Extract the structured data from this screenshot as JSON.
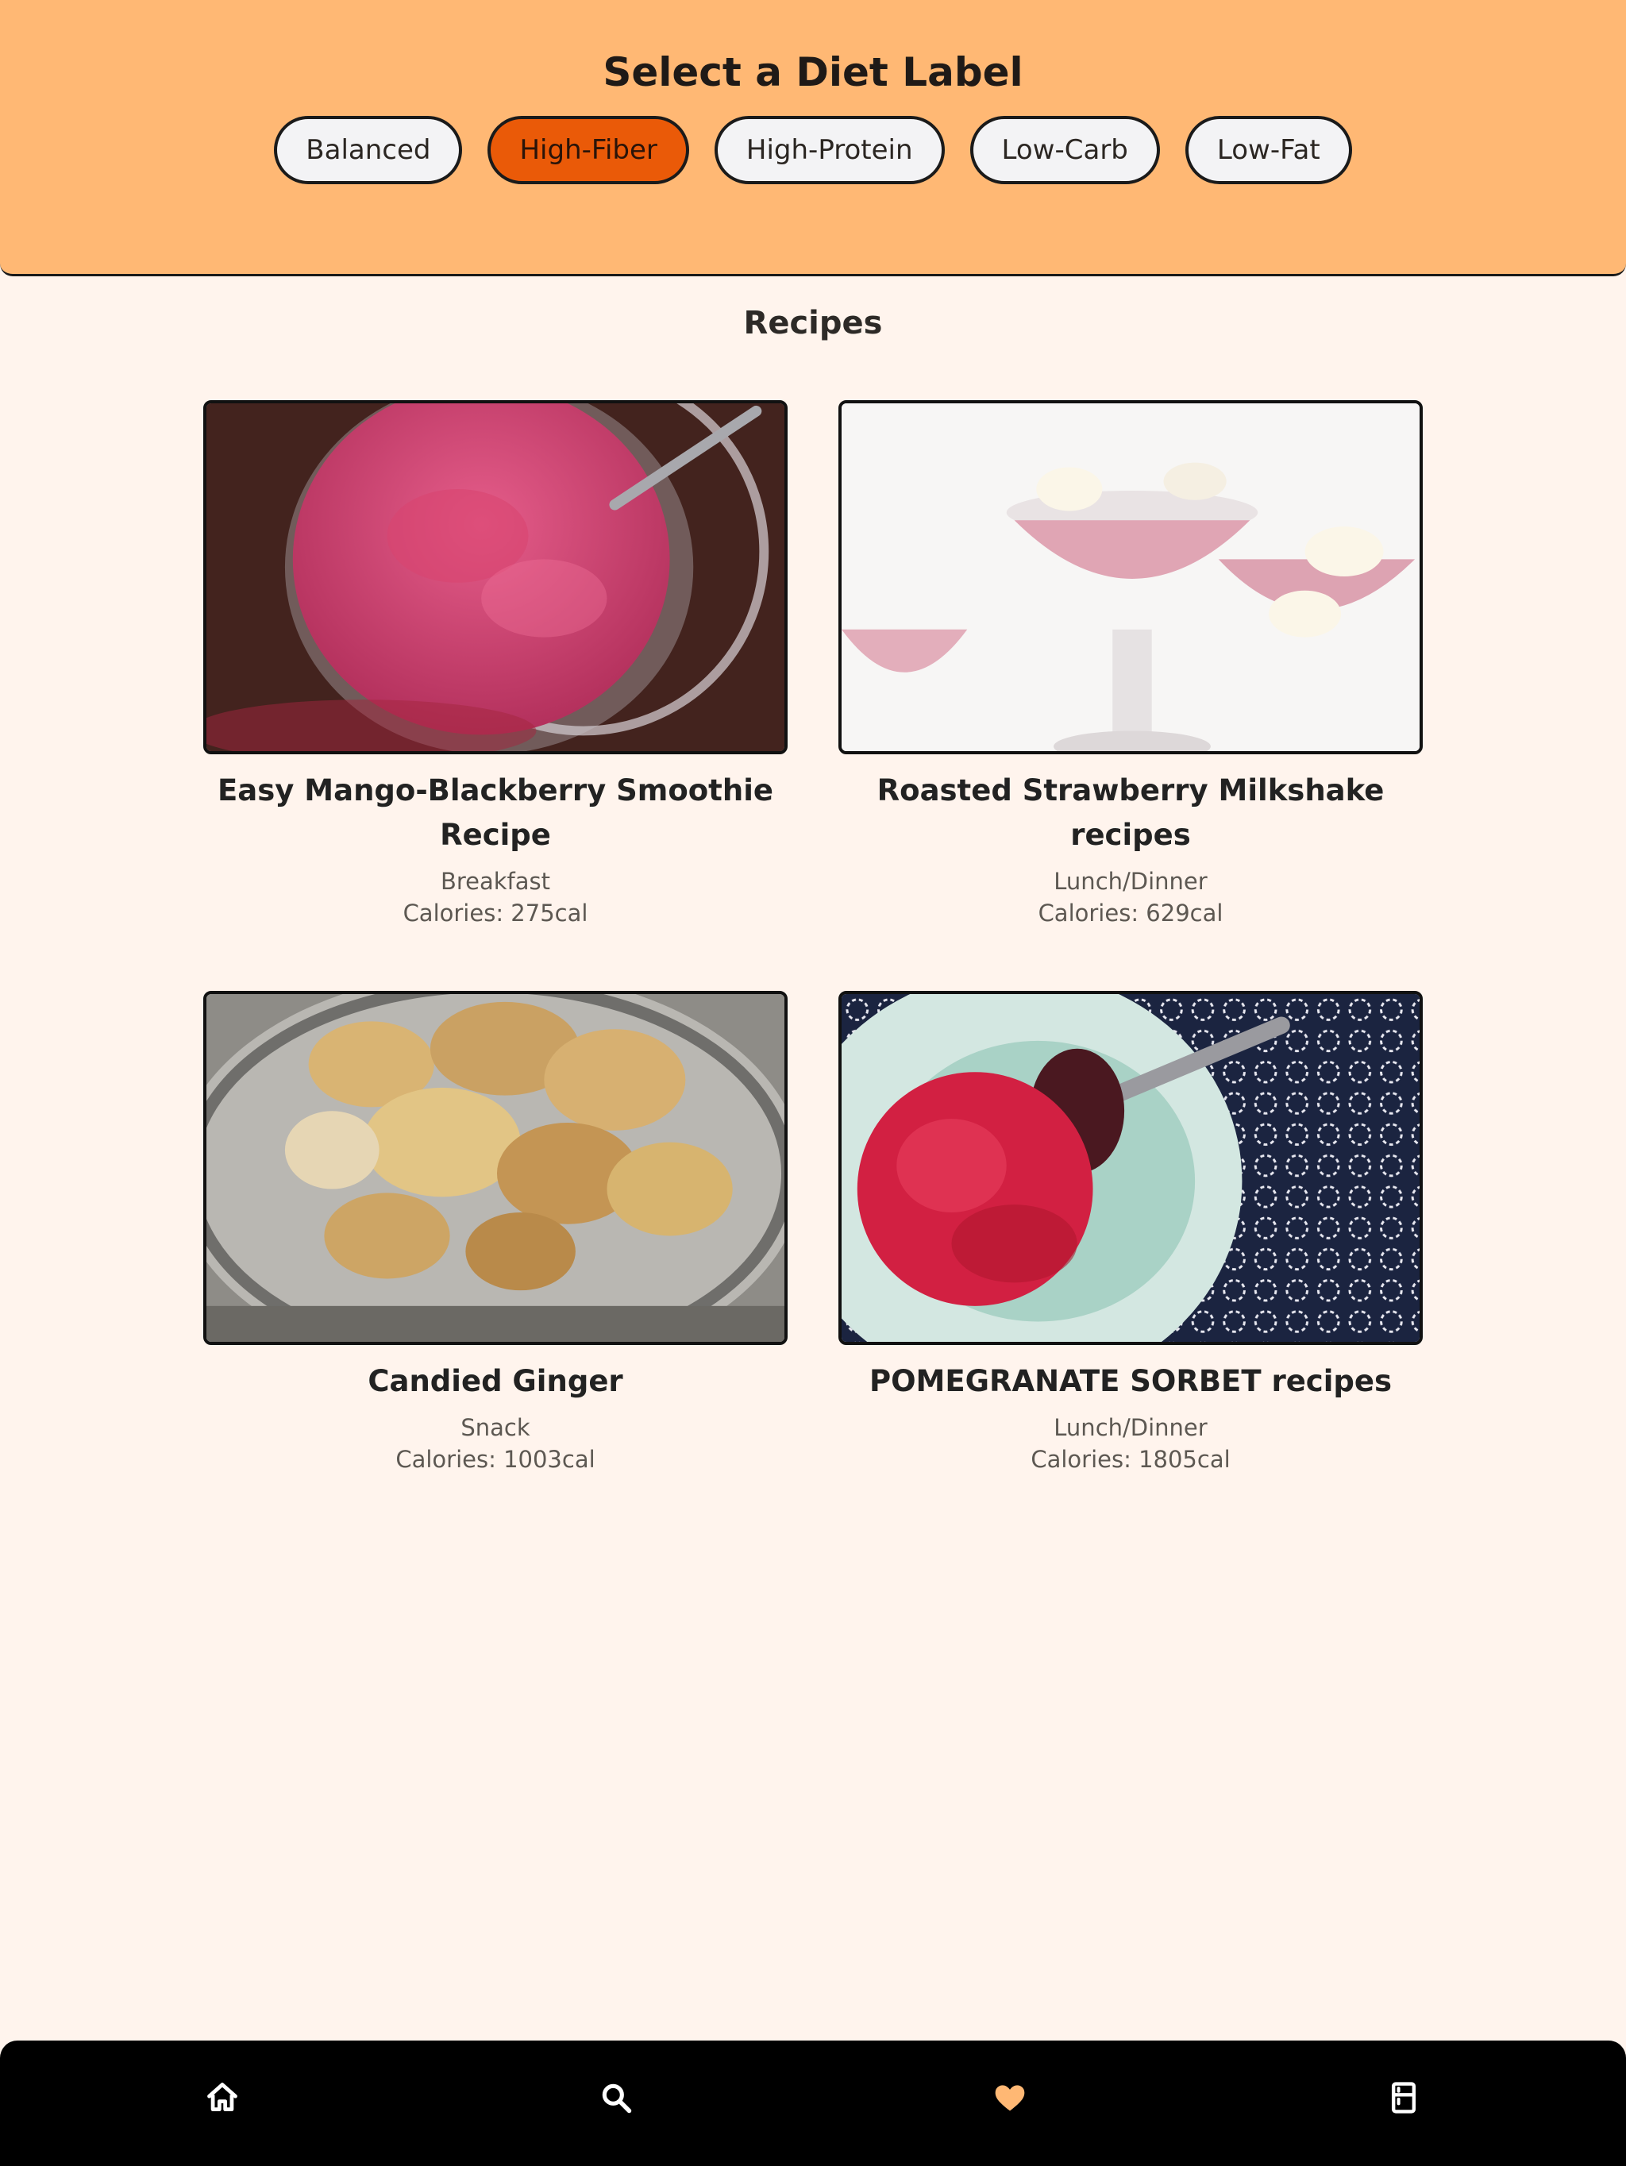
{
  "header": {
    "title": "Select a Diet Label",
    "labels": [
      {
        "label": "Balanced",
        "active": false
      },
      {
        "label": "High-Fiber",
        "active": true
      },
      {
        "label": "High-Protein",
        "active": false
      },
      {
        "label": "Low-Carb",
        "active": false
      },
      {
        "label": "Low-Fat",
        "active": false
      }
    ]
  },
  "section": {
    "title": "Recipes"
  },
  "recipes": [
    {
      "title": "Easy Mango-Blackberry Smoothie Recipe",
      "meal": "Breakfast",
      "calories": "Calories: 275cal"
    },
    {
      "title": "Roasted Strawberry Milkshake recipes",
      "meal": "Lunch/Dinner",
      "calories": "Calories: 629cal"
    },
    {
      "title": "Candied Ginger",
      "meal": "Snack",
      "calories": "Calories: 1003cal"
    },
    {
      "title": "POMEGRANATE SORBET recipes",
      "meal": "Lunch/Dinner",
      "calories": "Calories: 1805cal"
    }
  ],
  "nav": {
    "items": [
      {
        "icon": "home-icon"
      },
      {
        "icon": "search-icon"
      },
      {
        "icon": "heart-icon",
        "active": true,
        "color": "#ffb874"
      },
      {
        "icon": "fridge-icon"
      }
    ]
  },
  "colors": {
    "header_bg": "#ffb874",
    "active_chip": "#ea5a08",
    "page_bg": "#fff4ed",
    "nav_bg": "#000000"
  }
}
